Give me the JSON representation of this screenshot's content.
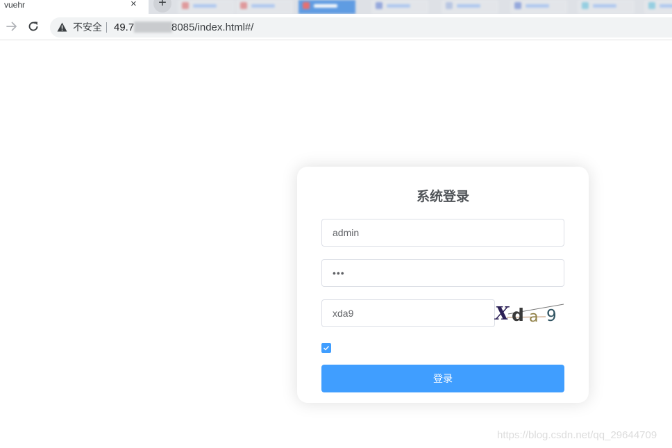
{
  "browser": {
    "tab_title": "vuehr",
    "tab_close": "×",
    "new_tab": "+",
    "security_label": "不安全",
    "url_prefix": "49.7",
    "url_suffix": "8085/index.html#/",
    "accent_color": "#409eff"
  },
  "login": {
    "title": "系统登录",
    "username_value": "admin",
    "password_value": "•••",
    "code_value": "xda9",
    "captcha_chars": [
      "X",
      "d",
      "a",
      "9"
    ],
    "remember_checked": true,
    "submit_label": "登录"
  },
  "watermark": "https://blog.csdn.net/qq_29644709",
  "icons": {
    "forward": "arrow-forward-icon",
    "reload": "reload-icon",
    "warning": "warning-triangle-icon",
    "check": "checkmark-icon"
  }
}
